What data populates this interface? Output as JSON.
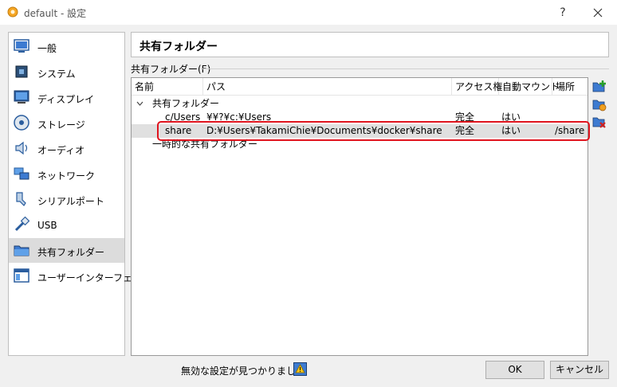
{
  "window": {
    "title": "default - 設定",
    "help_label": "?"
  },
  "sidebar": {
    "items": [
      {
        "label": "一般",
        "icon": "general-icon"
      },
      {
        "label": "システム",
        "icon": "system-chip-icon"
      },
      {
        "label": "ディスプレイ",
        "icon": "display-monitor-icon"
      },
      {
        "label": "ストレージ",
        "icon": "storage-disk-icon"
      },
      {
        "label": "オーディオ",
        "icon": "audio-speaker-icon"
      },
      {
        "label": "ネットワーク",
        "icon": "network-icon"
      },
      {
        "label": "シリアルポート",
        "icon": "serial-port-icon"
      },
      {
        "label": "USB",
        "icon": "usb-icon"
      },
      {
        "label": "共有フォルダー",
        "icon": "shared-folder-icon",
        "active": true
      },
      {
        "label": "ユーザーインターフェース",
        "icon": "user-interface-icon"
      }
    ]
  },
  "main": {
    "page_title": "共有フォルダー",
    "group_label": "共有フォルダー(F)",
    "columns": [
      "名前",
      "パス",
      "アクセス権",
      "自動マウント",
      "場所"
    ],
    "groups": [
      {
        "label": "共有フォルダー",
        "expanded": true,
        "rows": [
          {
            "name": "c/Users",
            "path": "¥¥?¥c:¥Users",
            "access": "完全",
            "automount": "はい",
            "location": ""
          },
          {
            "name": "share",
            "path": "D:¥Users¥TakamiChie¥Documents¥docker¥share",
            "access": "完全",
            "automount": "はい",
            "location": "/share",
            "selected": true
          }
        ]
      },
      {
        "label": "一時的な共有フォルダー",
        "rows": []
      }
    ],
    "toolbar": [
      "add-shared-folder-icon",
      "edit-shared-folder-icon",
      "remove-shared-folder-icon"
    ]
  },
  "footer": {
    "warning_text": "無効な設定が見つかりました",
    "ok_label": "OK",
    "cancel_label": "キャンセル"
  },
  "colors": {
    "selection": "#e0e0e0",
    "highlight_border": "#e0141e"
  }
}
